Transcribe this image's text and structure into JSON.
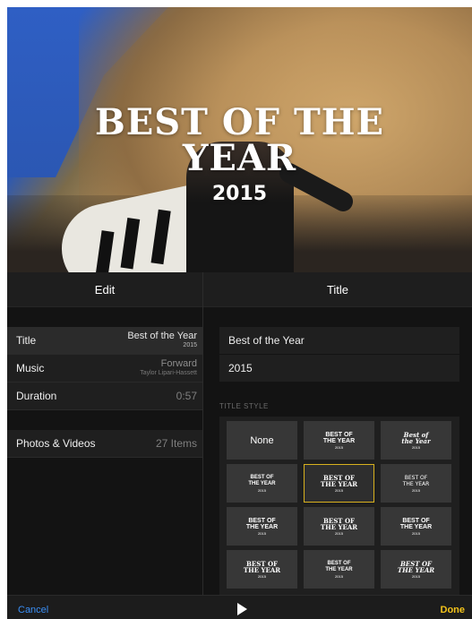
{
  "hero": {
    "title_line1": "BEST OF THE",
    "title_line2": "YEAR",
    "year": "2015"
  },
  "headers": {
    "left": "Edit",
    "right": "Title"
  },
  "settings": {
    "title_label": "Title",
    "title_value": "Best of the Year",
    "title_year": "2015",
    "music_label": "Music",
    "music_value": "Forward",
    "music_artist": "Taylor Lipari-Hassett",
    "duration_label": "Duration",
    "duration_value": "0:57",
    "photos_label": "Photos & Videos",
    "photos_value": "27 Items"
  },
  "title_fields": {
    "line1": "Best of the Year",
    "line2": "2015"
  },
  "title_style": {
    "section_label": "TITLE STYLE",
    "none_label": "None",
    "tiles": [
      {
        "l1": "BEST OF",
        "l2": "THE YEAR",
        "y": "2015"
      },
      {
        "l1": "Best of",
        "l2": "the Year",
        "y": "2015"
      },
      {
        "l1": "BEST OF",
        "l2": "THE YEAR",
        "y": "2015"
      },
      {
        "l1": "BEST OF",
        "l2": "THE YEAR",
        "y": "2015"
      },
      {
        "l1": "BEST OF",
        "l2": "THE YEAR",
        "y": "2015"
      },
      {
        "l1": "BEST OF",
        "l2": "THE YEAR",
        "y": "2015"
      },
      {
        "l1": "BEST OF",
        "l2": "THE YEAR",
        "y": "2015"
      },
      {
        "l1": "BEST OF",
        "l2": "THE YEAR",
        "y": "2015"
      },
      {
        "l1": "BEST OF",
        "l2": "THE YEAR",
        "y": "2015"
      },
      {
        "l1": "BEST OF",
        "l2": "THE YEAR",
        "y": "2015"
      },
      {
        "l1": "BEST OF",
        "l2": "THE YEAR",
        "y": "2015"
      }
    ]
  },
  "bottom_bar": {
    "cancel": "Cancel",
    "done": "Done",
    "play_icon": "play-icon"
  },
  "colors": {
    "accent_blue": "#3a8ef5",
    "accent_yellow": "#f2c21a",
    "selection_border": "#d8b11e"
  }
}
